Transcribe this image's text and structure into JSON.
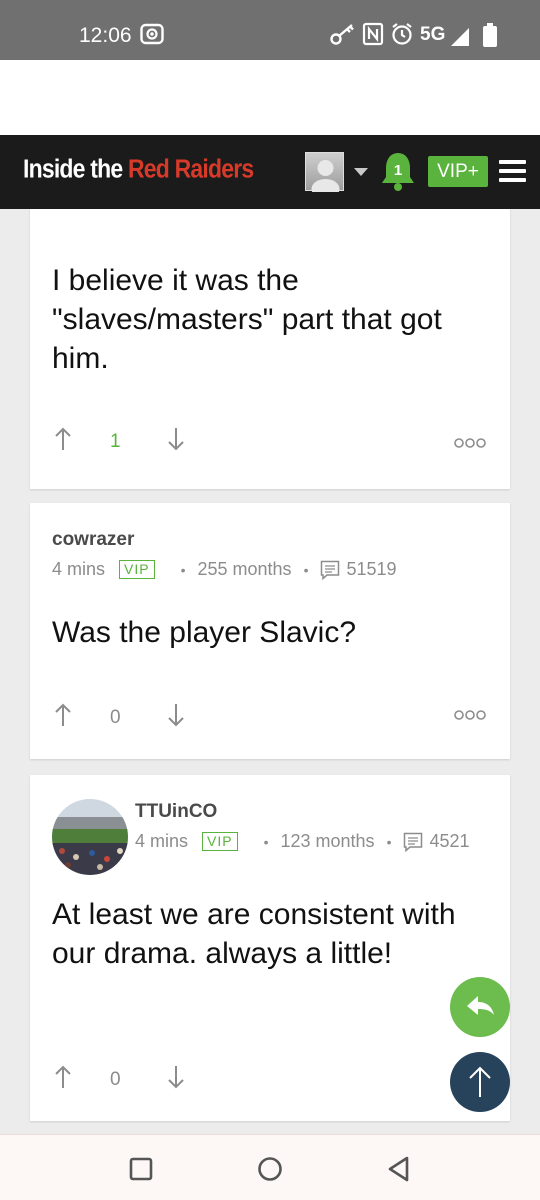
{
  "status_bar": {
    "time": "12:06",
    "network": "5G",
    "icons": [
      "screen-record-icon",
      "key-icon",
      "nfc-icon",
      "alarm-icon",
      "signal-icon",
      "battery-icon"
    ]
  },
  "header": {
    "brand_prefix": "Inside the ",
    "brand_highlight": "Red Raiders",
    "notification_count": "1",
    "vip_label": "VIP+",
    "colors": {
      "brand_red": "#d83a2a",
      "accent_green": "#5ab33c",
      "header_bg": "#1b1b1b"
    }
  },
  "posts": [
    {
      "text": "I believe it was the \"slaves/masters\" part that got him.",
      "votes": "1"
    },
    {
      "username": "cowrazer",
      "time_ago": "4 mins",
      "badge": "VIP",
      "membership": "255 months",
      "post_count": "51519",
      "text": "Was the player Slavic?",
      "votes": "0"
    },
    {
      "username": "TTUinCO",
      "time_ago": "4 mins",
      "badge": "VIP",
      "membership": "123 months",
      "post_count": "4521",
      "text": "At least we are consistent with our drama. always a little!",
      "votes": "0"
    }
  ],
  "fabs": {
    "reply_icon": "reply-icon",
    "top_icon": "arrow-up-icon"
  },
  "android_nav": [
    "recents-button",
    "home-button",
    "back-button"
  ]
}
